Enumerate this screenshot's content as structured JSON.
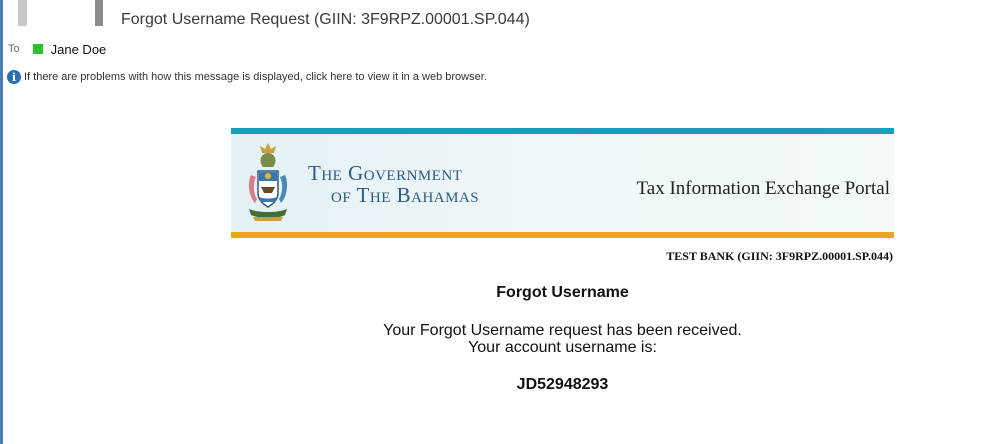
{
  "message": {
    "subject": "Forgot Username Request (GIIN: 3F9RPZ.00001.SP.044)",
    "to_label": "To",
    "recipient": "Jane Doe",
    "info_text": "If there are problems with how this message is displayed, click here to view it in a web browser.",
    "info_icon": "i"
  },
  "email": {
    "gov_line1": "The Government",
    "gov_line2": "of The Bahamas",
    "portal_title": "Tax Information Exchange Portal",
    "bank_line": "TEST BANK (GIIN: 3F9RPZ.00001.SP.044)",
    "heading": "Forgot Username",
    "body_line1": "Your Forgot Username request has been received.",
    "body_line2": "Your account username is:",
    "username": "JD52948293"
  },
  "colors": {
    "banner_top": "#1d9bbd",
    "banner_bottom": "#e8a817",
    "gov_title": "#2d5a80",
    "presence": "#2fc02f",
    "info_icon": "#2a6fb8"
  }
}
